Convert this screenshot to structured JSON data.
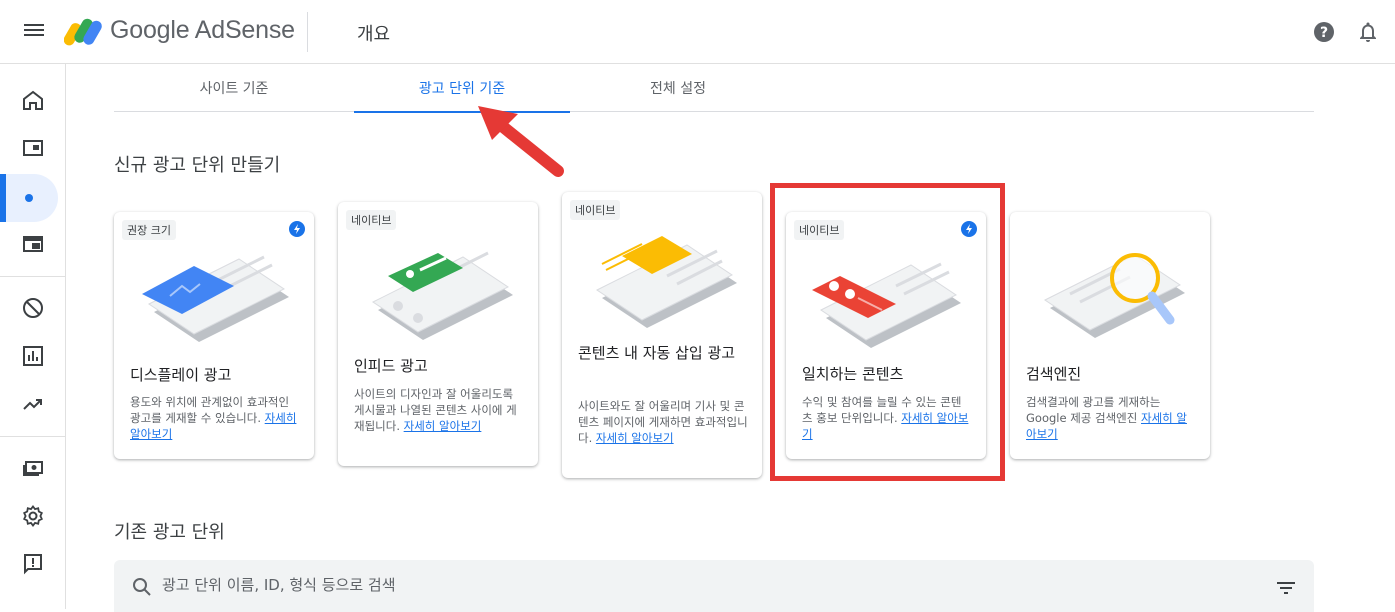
{
  "app": {
    "brand": "Google AdSense",
    "page_title": "개요"
  },
  "tabs": [
    {
      "label": "사이트 기준",
      "active": false
    },
    {
      "label": "광고 단위 기준",
      "active": true
    },
    {
      "label": "전체 설정",
      "active": false
    }
  ],
  "new_section": {
    "title": "신규 광고 단위 만들기"
  },
  "cards": [
    {
      "badge": "권장 크기",
      "title": "디스플레이 광고",
      "desc": "용도와 위치에 관계없이 효과적인 광고를 게재할 수 있습니다.",
      "link": "자세히 알아보기"
    },
    {
      "badge": "네이티브",
      "title": "인피드 광고",
      "desc": "사이트의 디자인과 잘 어울리도록 게시물과 나열된 콘텐츠 사이에 게재됩니다.",
      "link": "자세히 알아보기"
    },
    {
      "badge": "네이티브",
      "title": "콘텐츠 내 자동 삽입 광고",
      "desc": "사이트와도 잘 어울리며 기사 및 콘텐츠 페이지에 게재하면 효과적입니다.",
      "link": "자세히 알아보기"
    },
    {
      "badge": "네이티브",
      "title": "일치하는 콘텐츠",
      "desc": "수익 및 참여를 늘릴 수 있는 콘텐츠 홍보 단위입니다.",
      "link": "자세히 알아보기"
    },
    {
      "badge": "",
      "title": "검색엔진",
      "desc": "검색결과에 광고를 게재하는 Google 제공 검색엔진",
      "link": "자세히 알아보기"
    }
  ],
  "existing_section": {
    "title": "기존 광고 단위"
  },
  "search": {
    "placeholder": "광고 단위 이름, ID, 형식 등으로 검색"
  },
  "colors": {
    "accent": "#1a73e8",
    "annotation": "#e53935",
    "bolt": "#1a73e8"
  },
  "icons": [
    "menu-icon",
    "adsense-logo",
    "help-icon",
    "bell-icon",
    "home-icon",
    "sites-icon",
    "ads-icon",
    "auto-ads-icon",
    "block-icon",
    "reports-icon",
    "optimize-icon",
    "payments-icon",
    "settings-icon",
    "feedback-icon",
    "search-icon",
    "filter-icon",
    "bolt-icon"
  ]
}
